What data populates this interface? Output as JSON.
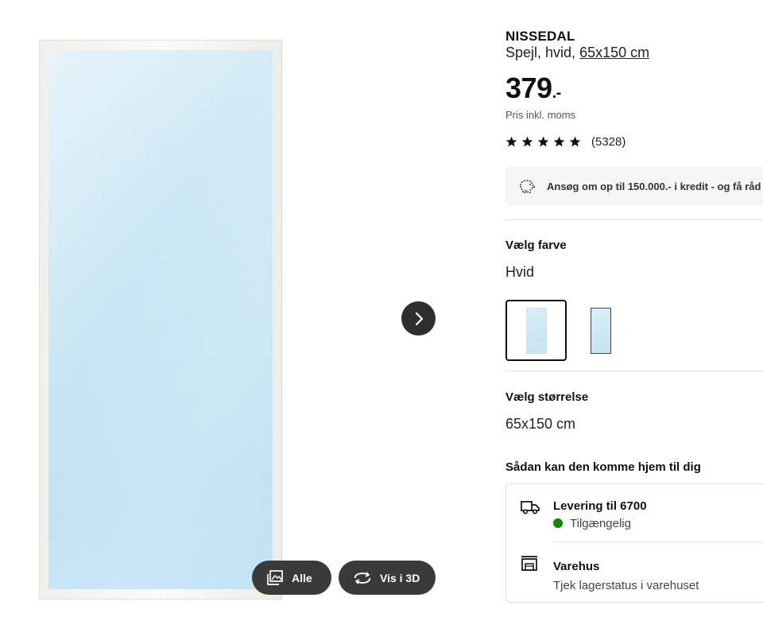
{
  "gallery": {
    "next_label": "Next image",
    "all_label": "Alle",
    "view3d_label": "Vis i 3D"
  },
  "product": {
    "name": "NISSEDAL",
    "description": "Spejl, hvid,",
    "size_link": "65x150 cm",
    "price": "379",
    "price_suffix": ".-",
    "vat_note": "Pris inkl. moms",
    "rating_stars": 4.5,
    "review_count": "(5328)"
  },
  "credit": {
    "text": "Ansøg om op til 150.000.- i kredit - og få råd"
  },
  "color": {
    "title": "Vælg farve",
    "selected": "Hvid",
    "options": [
      "Hvid",
      "Sort"
    ]
  },
  "size": {
    "title": "Vælg størrelse",
    "selected": "65x150 cm"
  },
  "delivery": {
    "title": "Sådan kan den komme hjem til dig",
    "shipping_title": "Levering til 6700",
    "shipping_status": "Tilgængelig",
    "shipping_status_color": "#0a8a00",
    "store_title": "Varehus",
    "store_sub": "Tjek lagerstatus i varehuset"
  }
}
